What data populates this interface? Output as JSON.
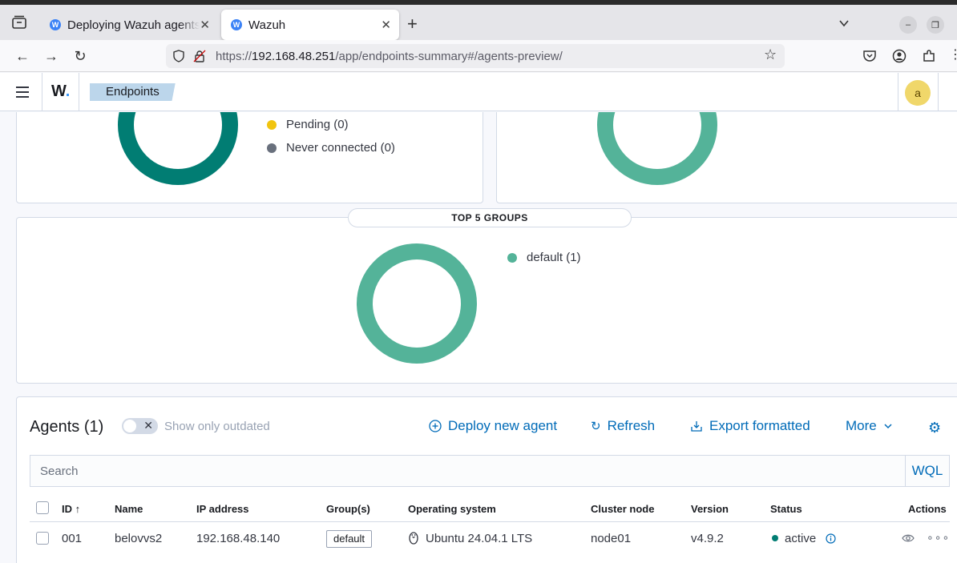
{
  "browser": {
    "tabs": [
      {
        "title": "Deploying Wazuh agents",
        "favicon": "W"
      },
      {
        "title": "Wazuh",
        "favicon": "W"
      }
    ],
    "url": {
      "scheme": "https://",
      "host": "192.168.48.251",
      "path": "/app/endpoints-summary#/agents-preview/"
    }
  },
  "header": {
    "logo": "W",
    "logo_dot": ".",
    "breadcrumb": "Endpoints",
    "avatar": "a"
  },
  "status_panel": {
    "legend": [
      {
        "label": "Pending (0)",
        "color": "#f1c40f"
      },
      {
        "label": "Never connected (0)",
        "color": "#69707d"
      }
    ],
    "donut_color": "#017d73"
  },
  "os_panel": {
    "donut_color": "#54b399"
  },
  "groups_panel": {
    "title": "TOP 5 GROUPS",
    "legend": [
      {
        "label": "default (1)",
        "color": "#54b399"
      }
    ],
    "donut_color": "#54b399"
  },
  "agents": {
    "title": "Agents (1)",
    "toggle_label": "Show only outdated",
    "actions": {
      "deploy": "Deploy new agent",
      "refresh": "Refresh",
      "export": "Export formatted",
      "more": "More"
    },
    "search_placeholder": "Search",
    "wql": "WQL",
    "columns": [
      "ID",
      "Name",
      "IP address",
      "Group(s)",
      "Operating system",
      "Cluster node",
      "Version",
      "Status",
      "Actions"
    ],
    "rows": [
      {
        "id": "001",
        "name": "belovvs2",
        "ip": "192.168.48.140",
        "group": "default",
        "os": "Ubuntu 24.04.1 LTS",
        "cluster_node": "node01",
        "version": "v4.9.2",
        "status": "active"
      }
    ]
  }
}
